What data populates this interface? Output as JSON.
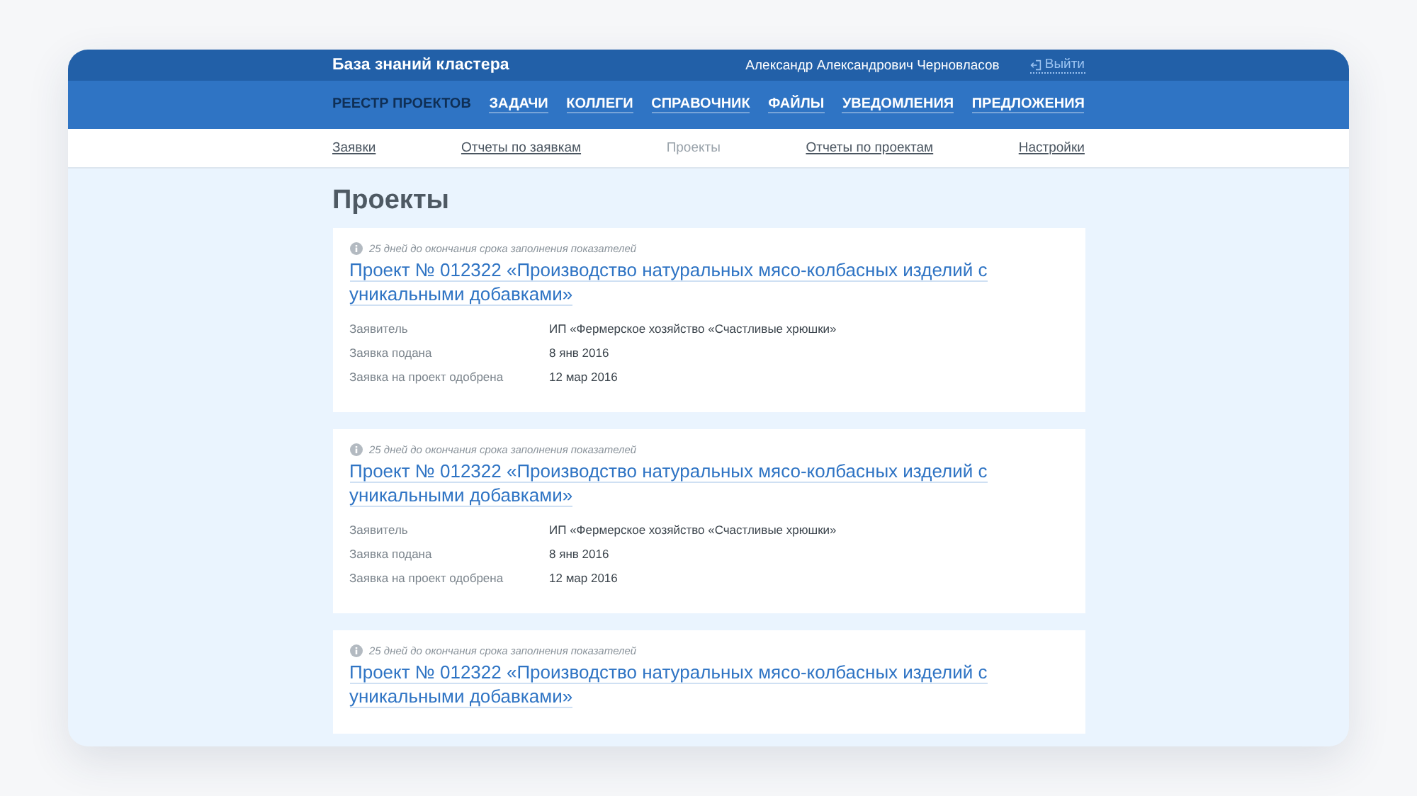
{
  "header": {
    "title": "База знаний кластера",
    "user": "Александр Александрович Черновласов",
    "logout": "Выйти"
  },
  "nav": [
    {
      "label": "РЕЕСТР ПРОЕКТОВ",
      "selected": true
    },
    {
      "label": "ЗАДАЧИ",
      "selected": false
    },
    {
      "label": "КОЛЛЕГИ",
      "selected": false
    },
    {
      "label": "СПРАВОЧНИК",
      "selected": false
    },
    {
      "label": "ФАЙЛЫ",
      "selected": false
    },
    {
      "label": "УВЕДОМЛЕНИЯ",
      "selected": false
    },
    {
      "label": "ПРЕДЛОЖЕНИЯ",
      "selected": false
    }
  ],
  "subnav": [
    {
      "label": "Заявки",
      "selected": false
    },
    {
      "label": "Отчеты по заявкам",
      "selected": false
    },
    {
      "label": "Проекты",
      "selected": true
    },
    {
      "label": "Отчеты по проектам",
      "selected": false
    },
    {
      "label": "Настройки",
      "selected": false
    }
  ],
  "page_title": "Проекты",
  "projects": [
    {
      "notice": "25 дней до окончания срока заполнения показателей",
      "title": "Проект № 012322 «Производство натуральных мясо-колбасных изделий с уникальными добавками»",
      "fields": [
        {
          "label": "Заявитель",
          "value": "ИП «Фермерское хозяйство «Счастливые хрюшки»"
        },
        {
          "label": "Заявка подана",
          "value": "8 янв 2016"
        },
        {
          "label": "Заявка на проект одобрена",
          "value": "12 мар 2016"
        }
      ]
    },
    {
      "notice": "25 дней до окончания срока заполнения показателей",
      "title": "Проект № 012322 «Производство натуральных мясо-колбасных изделий с уникальными добавками»",
      "fields": [
        {
          "label": "Заявитель",
          "value": "ИП «Фермерское хозяйство «Счастливые хрюшки»"
        },
        {
          "label": "Заявка подана",
          "value": "8 янв 2016"
        },
        {
          "label": "Заявка на проект одобрена",
          "value": "12 мар 2016"
        }
      ]
    },
    {
      "notice": "25 дней до окончания срока заполнения показателей",
      "title": "Проект № 012322 «Производство натуральных мясо-колбасных изделий с уникальными добавками»"
    }
  ]
}
